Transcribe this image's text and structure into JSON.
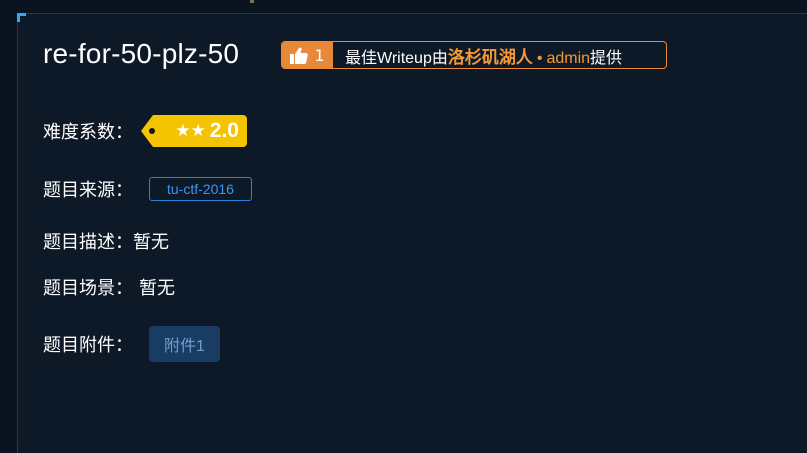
{
  "challenge": {
    "title": "re-for-50-plz-50"
  },
  "writeup": {
    "likes": "1",
    "prefix": "最佳Writeup由",
    "author": "洛杉矶湖人",
    "separator": "•",
    "admin": "admin",
    "suffix": "提供",
    "color": "#e8893a"
  },
  "difficulty": {
    "label": "难度系数：",
    "stars": "★★",
    "score": "2.0",
    "color": "#f5c400"
  },
  "source": {
    "label": "题目来源：",
    "tag": "tu-ctf-2016",
    "color": "#2f7fdc"
  },
  "description": {
    "label": "题目描述：",
    "value": "暂无"
  },
  "scene": {
    "label": "题目场景：",
    "value": "暂无"
  },
  "attachment": {
    "label": "题目附件：",
    "button": "附件1"
  },
  "icons": {
    "like": "thumbs-up-icon"
  }
}
